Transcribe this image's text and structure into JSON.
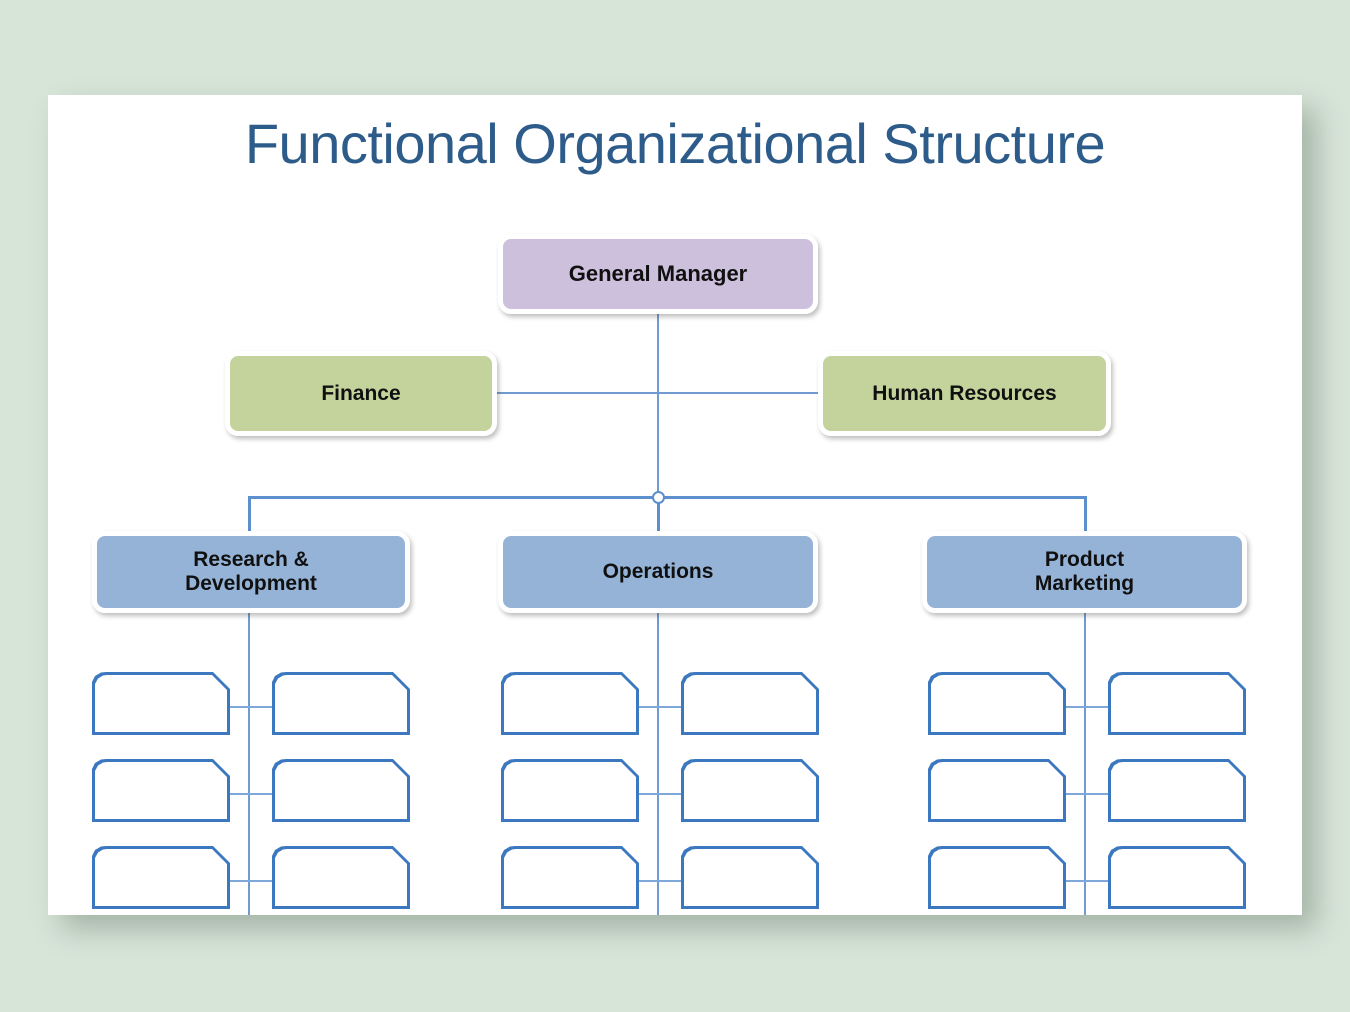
{
  "canvas": {
    "background_color": "#d7e4d8",
    "panel_color": "#ffffff"
  },
  "slide": {
    "title": "Functional Organizational Structure",
    "title_color": "#2e5c8a"
  },
  "colors": {
    "top_level_fill": "#cdc0dd",
    "support_fill": "#c3d39b",
    "division_fill": "#95b3d7",
    "leaf_outline": "#3c78c0",
    "leaf_fill": "#ffffff",
    "connector": "#6f9bd1",
    "box_border": "#ffffff"
  },
  "chart_data": {
    "type": "diagram",
    "diagram_type": "organizational-chart",
    "title": "Functional Organizational Structure",
    "levels": 4,
    "nodes": [
      {
        "id": "gm",
        "label": "General Manager",
        "level": 1,
        "fill": "#cdc0dd",
        "parent": null
      },
      {
        "id": "finance",
        "label": "Finance",
        "level": 2,
        "fill": "#c3d39b",
        "parent": "gm",
        "side": "left"
      },
      {
        "id": "hr",
        "label": "Human Resources",
        "level": 2,
        "fill": "#c3d39b",
        "parent": "gm",
        "side": "right"
      },
      {
        "id": "rnd",
        "label": "Research & Development",
        "level": 3,
        "fill": "#95b3d7",
        "parent": "gm"
      },
      {
        "id": "ops",
        "label": "Operations",
        "level": 3,
        "fill": "#95b3d7",
        "parent": "gm"
      },
      {
        "id": "pmk",
        "label": "Product Marketing",
        "level": 3,
        "fill": "#95b3d7",
        "parent": "gm"
      }
    ],
    "leaf_groups": [
      {
        "parent": "rnd",
        "rows": 3,
        "columns": 2,
        "labels": [
          [
            "",
            ""
          ],
          [
            "",
            ""
          ],
          [
            "",
            ""
          ]
        ]
      },
      {
        "parent": "ops",
        "rows": 3,
        "columns": 2,
        "labels": [
          [
            "",
            ""
          ],
          [
            "",
            ""
          ],
          [
            "",
            ""
          ]
        ]
      },
      {
        "parent": "pmk",
        "rows": 3,
        "columns": 2,
        "labels": [
          [
            "",
            ""
          ],
          [
            "",
            ""
          ],
          [
            "",
            ""
          ]
        ]
      }
    ],
    "leaf_count": 18,
    "leaf_state": "empty"
  },
  "boxes": {
    "general_manager": "General Manager",
    "finance": "Finance",
    "human_resources": "Human Resources",
    "research_development_line1": "Research &",
    "research_development_line2": "Development",
    "operations": "Operations",
    "product_marketing_line1": "Product",
    "product_marketing_line2": "Marketing"
  }
}
